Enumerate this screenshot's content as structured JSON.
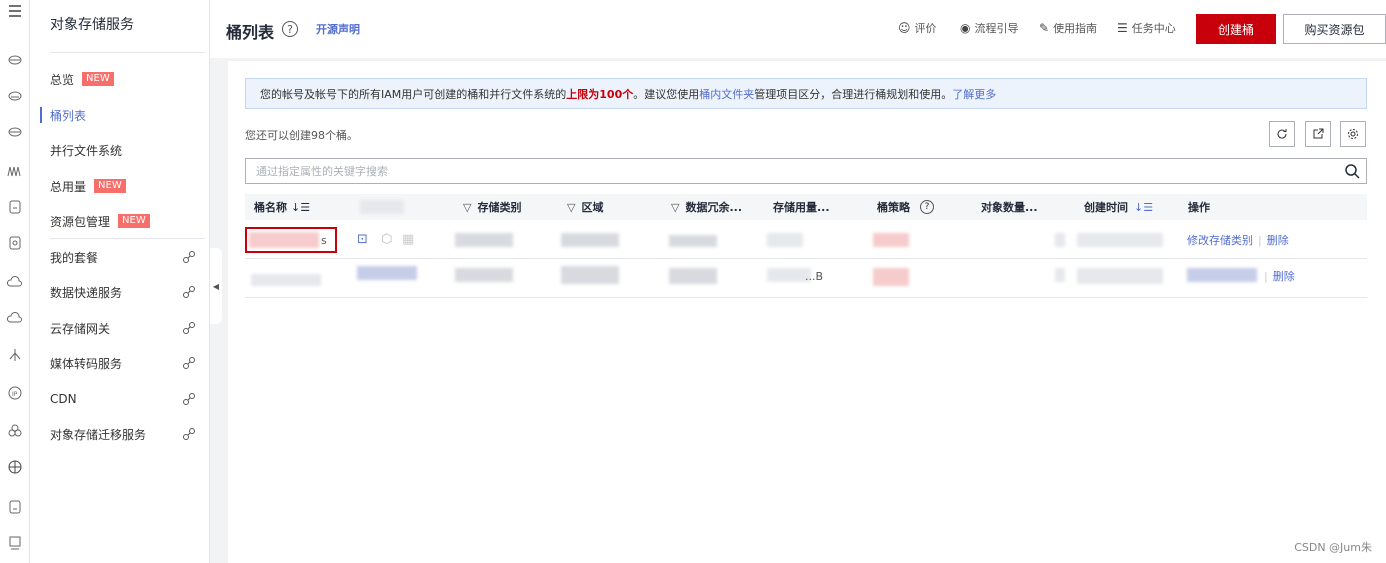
{
  "rail_icons": [
    "menu-icon",
    "cloud-icon",
    "cloud-icon",
    "cloud-icon",
    "wave-icon",
    "document-icon",
    "document-icon",
    "cloud-icon",
    "cloud-icon",
    "transfer-icon",
    "ip-icon",
    "cluster-icon",
    "globe-icon",
    "document-icon",
    "monitor-icon"
  ],
  "sidebar": {
    "title": "对象存储服务",
    "items": [
      {
        "label": "总览",
        "badge": "NEW"
      },
      {
        "label": "桶列表"
      },
      {
        "label": "并行文件系统"
      },
      {
        "label": "总用量",
        "badge": "NEW"
      },
      {
        "label": "资源包管理",
        "badge": "NEW"
      },
      {
        "label": "我的套餐"
      },
      {
        "label": "数据快递服务"
      },
      {
        "label": "云存储网关"
      },
      {
        "label": "媒体转码服务"
      },
      {
        "label": "CDN"
      },
      {
        "label": "对象存储迁移服务"
      }
    ]
  },
  "header": {
    "title": "桶列表",
    "help": "?",
    "open_source": "开源声明",
    "tools": [
      "评价",
      "流程引导",
      "使用指南",
      "任务中心"
    ],
    "create_button": "创建桶",
    "buy_button": "购买资源包"
  },
  "notice": {
    "part1": "您的帐号及帐号下的所有IAM用户可创建的桶和并行文件系统的",
    "limit": "上限为100个",
    "part2": "。建议您使用",
    "link": "桶内文件夹",
    "part3": "管理项目区分，合理进行桶规划和使用。",
    "learn_more": "了解更多"
  },
  "remaining": "您还可以创建98个桶。",
  "search": {
    "placeholder": "通过指定属性的关键字搜索"
  },
  "table": {
    "columns": [
      "桶名称",
      "存储类别",
      "区域",
      "数据冗余...",
      "存储用量...",
      "桶策略",
      "对象数量...",
      "创建时间",
      "操作"
    ],
    "rows": [
      {
        "name_suffix": "s",
        "usage": "",
        "actions": [
          "修改存储类别",
          "删除"
        ]
      },
      {
        "name_suffix": "",
        "usage": "...B",
        "actions": [
          "删除"
        ]
      }
    ]
  },
  "watermark": "CSDN @Jum朱"
}
